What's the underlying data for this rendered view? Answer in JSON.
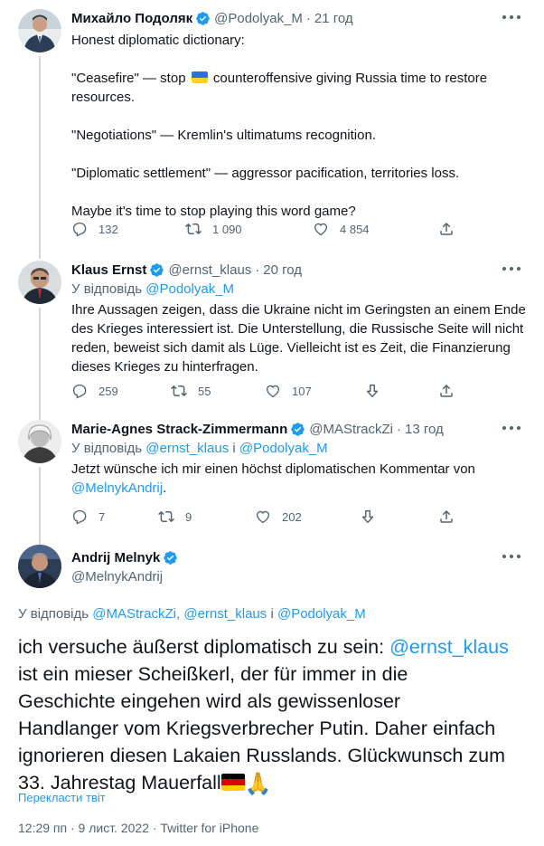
{
  "tweets": [
    {
      "name": "Михайло Подоляк",
      "handle": "@Podolyak_M",
      "time": "21 год",
      "lines": [
        "Honest diplomatic dictionary:",
        "\"Ceasefire\" — stop",
        "counteroffensive giving Russia time to restore",
        "resources.",
        "\"Negotiations\" — Kremlin's ultimatums recognition.",
        "\"Diplomatic settlement\" — aggressor pacification, territories loss.",
        "Maybe it's time to stop playing this word game?"
      ],
      "replies": "132",
      "retweets": "1 090",
      "likes": "4 854"
    },
    {
      "name": "Klaus Ernst",
      "handle": "@ernst_klaus",
      "time": "20 год",
      "reply_prefix": "У відповідь",
      "reply_to": "@Podolyak_M",
      "lines": [
        "Ihre Aussagen zeigen, dass die Ukraine nicht im Geringsten an einem Ende",
        "des Krieges interessiert ist. Die Unterstellung, die Russische Seite will nicht",
        "reden, beweist sich damit als Lüge. Vielleicht ist es Zeit, die Finanzierung",
        "dieses Krieges zu hinterfragen."
      ],
      "replies": "259",
      "retweets": "55",
      "likes": "107"
    },
    {
      "name": "Marie-Agnes Strack-Zimmermann",
      "handle": "@MAStrackZi",
      "time": "13 год",
      "reply_prefix": "У відповідь",
      "reply_to_1": "@ernst_klaus",
      "reply_and": "і",
      "reply_to_2": "@Podolyak_M",
      "line1": "Jetzt wünsche ich mir einen höchst diplomatischen Kommentar von",
      "mention": "@MelnykAndrij",
      "line2_suffix": ".",
      "replies": "7",
      "retweets": "9",
      "likes": "202"
    }
  ],
  "main": {
    "name": "Andrij Melnyk",
    "handle": "@MelnykAndrij",
    "reply_prefix": "У відповідь",
    "reply_to_1": "@MAStrackZi,",
    "reply_to_2": "@ernst_klaus",
    "reply_and": "і",
    "reply_to_3": "@Podolyak_M",
    "line1": "ich versuche äußerst diplomatisch zu sein:",
    "mention": "@ernst_klaus",
    "line2": "ist ein mieser Scheißkerl, der für immer in die",
    "line3": "Geschichte eingehen wird als gewissenloser",
    "line4": "Handlanger vom Kriegsverbrecher Putin. Daher einfach",
    "line5": "ignorieren diesen Lakaien Russlands. Glückwunsch zum",
    "line6": "33. Jahrestag Mauerfall",
    "translate": "Перекласти твіт",
    "meta": "12:29 пп · 9 лист. 2022 · Twitter for iPhone"
  },
  "colors": {
    "accent": "#1d9bf0",
    "secondary_text": "#536471",
    "primary_text": "#0f1419",
    "line": "#cfd9de"
  },
  "icons": [
    "verified-icon",
    "more-icon",
    "reply-icon",
    "retweet-icon",
    "like-icon",
    "share-icon",
    "downvote-icon",
    "ua-flag-icon",
    "de-flag-icon",
    "folded-hands-icon"
  ]
}
